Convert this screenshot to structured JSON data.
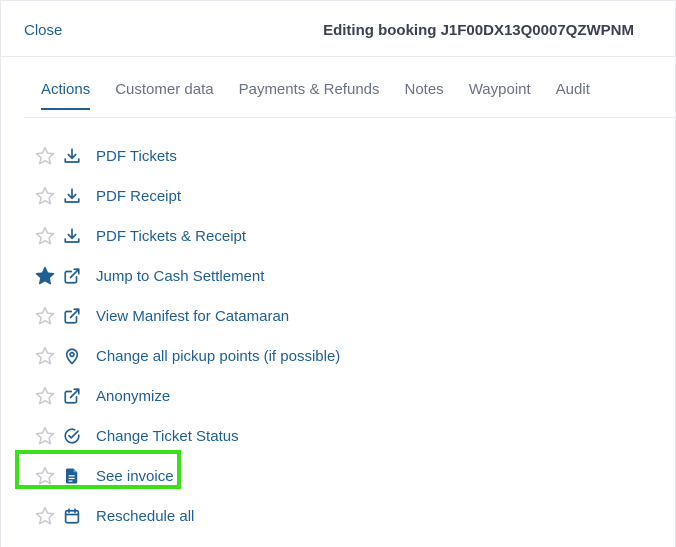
{
  "header": {
    "close_label": "Close",
    "title": "Editing booking J1F00DX13Q0007QZWPNM"
  },
  "tabs": [
    {
      "label": "Actions",
      "active": true
    },
    {
      "label": "Customer data",
      "active": false
    },
    {
      "label": "Payments & Refunds",
      "active": false
    },
    {
      "label": "Notes",
      "active": false
    },
    {
      "label": "Waypoint",
      "active": false
    },
    {
      "label": "Audit",
      "active": false
    }
  ],
  "actions": [
    {
      "label": "PDF Tickets",
      "icon": "download-icon",
      "starred": false
    },
    {
      "label": "PDF Receipt",
      "icon": "download-icon",
      "starred": false
    },
    {
      "label": "PDF Tickets & Receipt",
      "icon": "download-icon",
      "starred": false
    },
    {
      "label": "Jump to Cash Settlement",
      "icon": "external-link-icon",
      "starred": true
    },
    {
      "label": "View Manifest for Catamaran",
      "icon": "external-link-icon",
      "starred": false
    },
    {
      "label": "Change all pickup points (if possible)",
      "icon": "map-pin-icon",
      "starred": false
    },
    {
      "label": "Anonymize",
      "icon": "external-link-icon",
      "starred": false
    },
    {
      "label": "Change Ticket Status",
      "icon": "check-circle-icon",
      "starred": false
    },
    {
      "label": "See invoice",
      "icon": "document-icon",
      "starred": false,
      "highlighted": true
    },
    {
      "label": "Reschedule all",
      "icon": "calendar-icon",
      "starred": false
    }
  ],
  "colors": {
    "accent": "#1f5f93",
    "highlight": "#3ce01a",
    "muted_text": "#6b7280",
    "title_text": "#3b4150",
    "star_outline": "#c4c9d0",
    "star_filled": "#1f5f93"
  }
}
